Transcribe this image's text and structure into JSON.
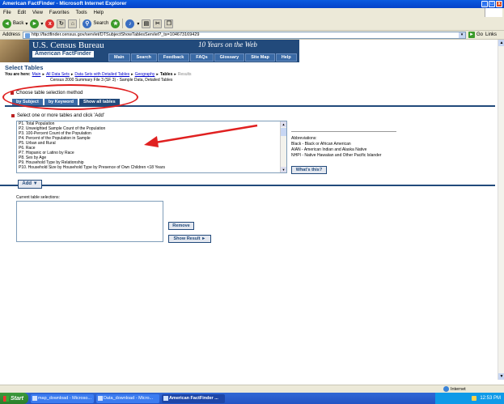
{
  "window": {
    "title": "American FactFinder - Microsoft Internet Explorer",
    "min": "_",
    "max": "□",
    "close": "x"
  },
  "menu": [
    "File",
    "Edit",
    "View",
    "Favorites",
    "Tools",
    "Help"
  ],
  "toolbar": {
    "back": "Back",
    "search": "Search"
  },
  "address": {
    "label": "Address",
    "url": "http://factfinder.census.gov/servlet/DTSubjectShowTablesServlet?_ts=104673169429",
    "go": "Go",
    "links": "Links"
  },
  "banner": {
    "census": "U.S. Census Bureau",
    "aff": "American FactFinder",
    "years": "10 Years on the Web",
    "nav": [
      "Main",
      "Search",
      "Feedback",
      "FAQs",
      "Glossary",
      "Site Map",
      "Help"
    ]
  },
  "page": {
    "title": "Select Tables",
    "crumb_prefix": "You are here:",
    "crumbs": [
      "Main",
      "All Data Sets",
      "Data Sets with Detailed Tables",
      "Geography"
    ],
    "crumb_current": "Tables",
    "crumb_next": "Results",
    "dataset": "Census 2000 Summary File 3 (SF 3) - Sample Data, Detailed Tables",
    "method_label": "Choose table selection method",
    "tabs": [
      "by Subject",
      "by Keyword",
      "Show all tables"
    ],
    "select_label": "Select one or more tables and click 'Add'",
    "tables": [
      "P1. Total Population",
      "P2. Unweighted Sample Count of the Population",
      "P3. 100-Percent Count of the Population",
      "P4. Percent of the Population in Sample",
      "P5. Urban and Rural",
      "P6. Race",
      "P7. Hispanic or Latino by Race",
      "P8. Sex by Age",
      "P9. Household Type by Relationship",
      "P10. Household Size by Household Type by Presence of Own Children <18 Years"
    ],
    "abbrev_title": "Abbreviations:",
    "abbrevs": [
      "Black - Black or African American",
      "AIAN - American Indian and Alaska Native",
      "NHPI - Native Hawaiian and Other Pacific Islander"
    ],
    "whats_this": "What's this?",
    "add": "Add ▼",
    "current_label": "Current table selections:",
    "remove": "Remove",
    "show_result": "Show Result ►"
  },
  "status": {
    "zone": "Internet"
  },
  "taskbar": {
    "start": "Start",
    "tasks": [
      "map_download - Microso...",
      "Data_download - Micro...",
      "American FactFinder ..."
    ],
    "clock": "12:53 PM"
  },
  "colors": {
    "brand": "#224a7b",
    "annotation": "#e02020"
  }
}
